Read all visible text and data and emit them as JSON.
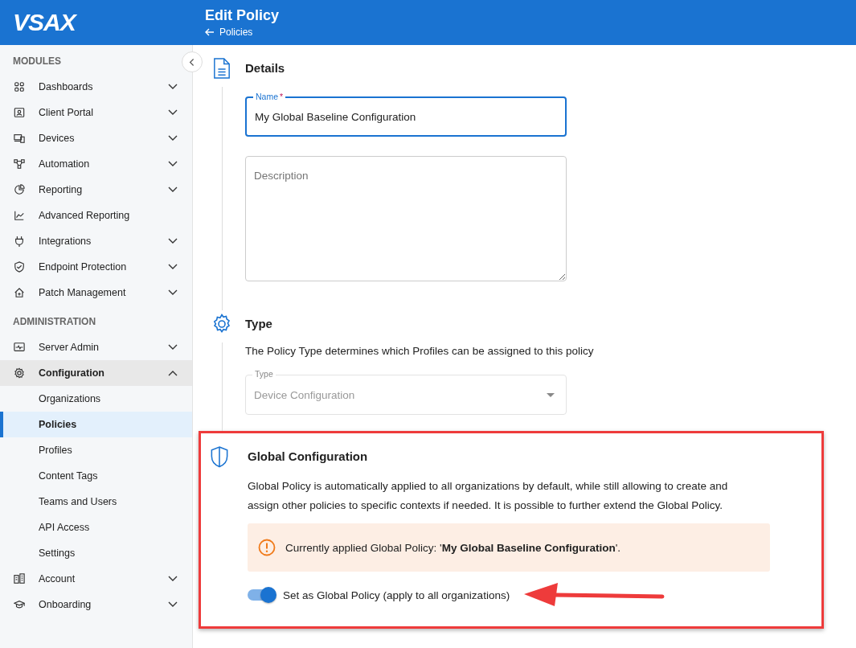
{
  "header": {
    "logo": "VSAX",
    "title": "Edit Policy",
    "back_link": "Policies"
  },
  "sidebar": {
    "sections": [
      {
        "title": "MODULES",
        "items": [
          {
            "label": "Dashboards",
            "expanded": false
          },
          {
            "label": "Client Portal",
            "expanded": false
          },
          {
            "label": "Devices",
            "expanded": false
          },
          {
            "label": "Automation",
            "expanded": false
          },
          {
            "label": "Reporting",
            "expanded": false
          },
          {
            "label": "Advanced Reporting"
          },
          {
            "label": "Integrations",
            "expanded": false
          },
          {
            "label": "Endpoint Protection",
            "expanded": false
          },
          {
            "label": "Patch Management",
            "expanded": false
          }
        ]
      },
      {
        "title": "ADMINISTRATION",
        "items": [
          {
            "label": "Server Admin",
            "expanded": false
          },
          {
            "label": "Configuration",
            "expanded": true,
            "children": [
              {
                "label": "Organizations",
                "selected": false
              },
              {
                "label": "Policies",
                "selected": true
              },
              {
                "label": "Profiles",
                "selected": false
              },
              {
                "label": "Content Tags",
                "selected": false
              },
              {
                "label": "Teams and Users",
                "selected": false
              },
              {
                "label": "API Access",
                "selected": false
              },
              {
                "label": "Settings",
                "selected": false
              }
            ]
          },
          {
            "label": "Account",
            "expanded": false
          },
          {
            "label": "Onboarding",
            "expanded": false
          }
        ]
      }
    ]
  },
  "details": {
    "title": "Details",
    "name_field": {
      "label": "Name",
      "required": true,
      "required_marker": "*",
      "value": "My Global Baseline Configuration"
    },
    "description_field": {
      "placeholder": "Description"
    }
  },
  "type": {
    "title": "Type",
    "description": "The Policy Type determines which Profiles can be assigned to this policy",
    "type_field": {
      "label": "Type",
      "value": "Device Configuration",
      "disabled": true
    }
  },
  "global": {
    "title": "Global Configuration",
    "description": "Global Policy is automatically applied to all organizations by default, while still allowing to create and assign other policies to specific contexts if needed. It is possible to further extend the Global Policy.",
    "alert": "Currently applied Global Policy: '**My Global Baseline Configuration**'.",
    "toggle": {
      "label": "Set as Global Policy (apply to all organizations)",
      "on": true
    }
  }
}
